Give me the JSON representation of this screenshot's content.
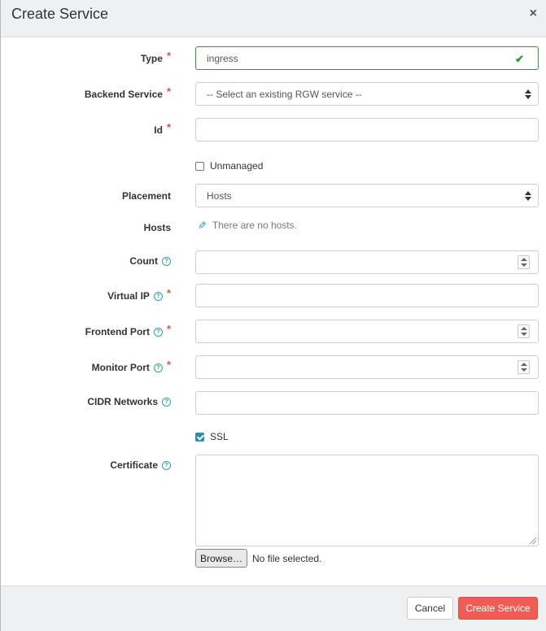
{
  "dialog": {
    "title": "Create Service",
    "close_symbol": "×"
  },
  "form": {
    "required_mark": "*",
    "help_symbol": "?",
    "type": {
      "label": "Type",
      "value": "ingress"
    },
    "backend_service": {
      "label": "Backend Service",
      "value": "-- Select an existing RGW service --"
    },
    "id": {
      "label": "Id",
      "value": ""
    },
    "unmanaged": {
      "label": "Unmanaged",
      "checked": false
    },
    "placement": {
      "label": "Placement",
      "value": "Hosts"
    },
    "hosts": {
      "label": "Hosts",
      "empty_text": "There are no hosts."
    },
    "count": {
      "label": "Count",
      "value": ""
    },
    "virtual_ip": {
      "label": "Virtual IP",
      "value": ""
    },
    "frontend_port": {
      "label": "Frontend Port",
      "value": ""
    },
    "monitor_port": {
      "label": "Monitor Port",
      "value": ""
    },
    "cidr_networks": {
      "label": "CIDR Networks",
      "value": ""
    },
    "ssl": {
      "label": "SSL",
      "checked": true
    },
    "certificate": {
      "label": "Certificate",
      "value": "",
      "browse_label": "Browse…",
      "file_status": "No file selected."
    }
  },
  "footer": {
    "cancel_label": "Cancel",
    "create_label": "Create Service"
  },
  "colors": {
    "primary": "#ef5c55",
    "accent": "#2a8fb0",
    "valid": "#2e9b2e",
    "required": "#d9534f"
  }
}
